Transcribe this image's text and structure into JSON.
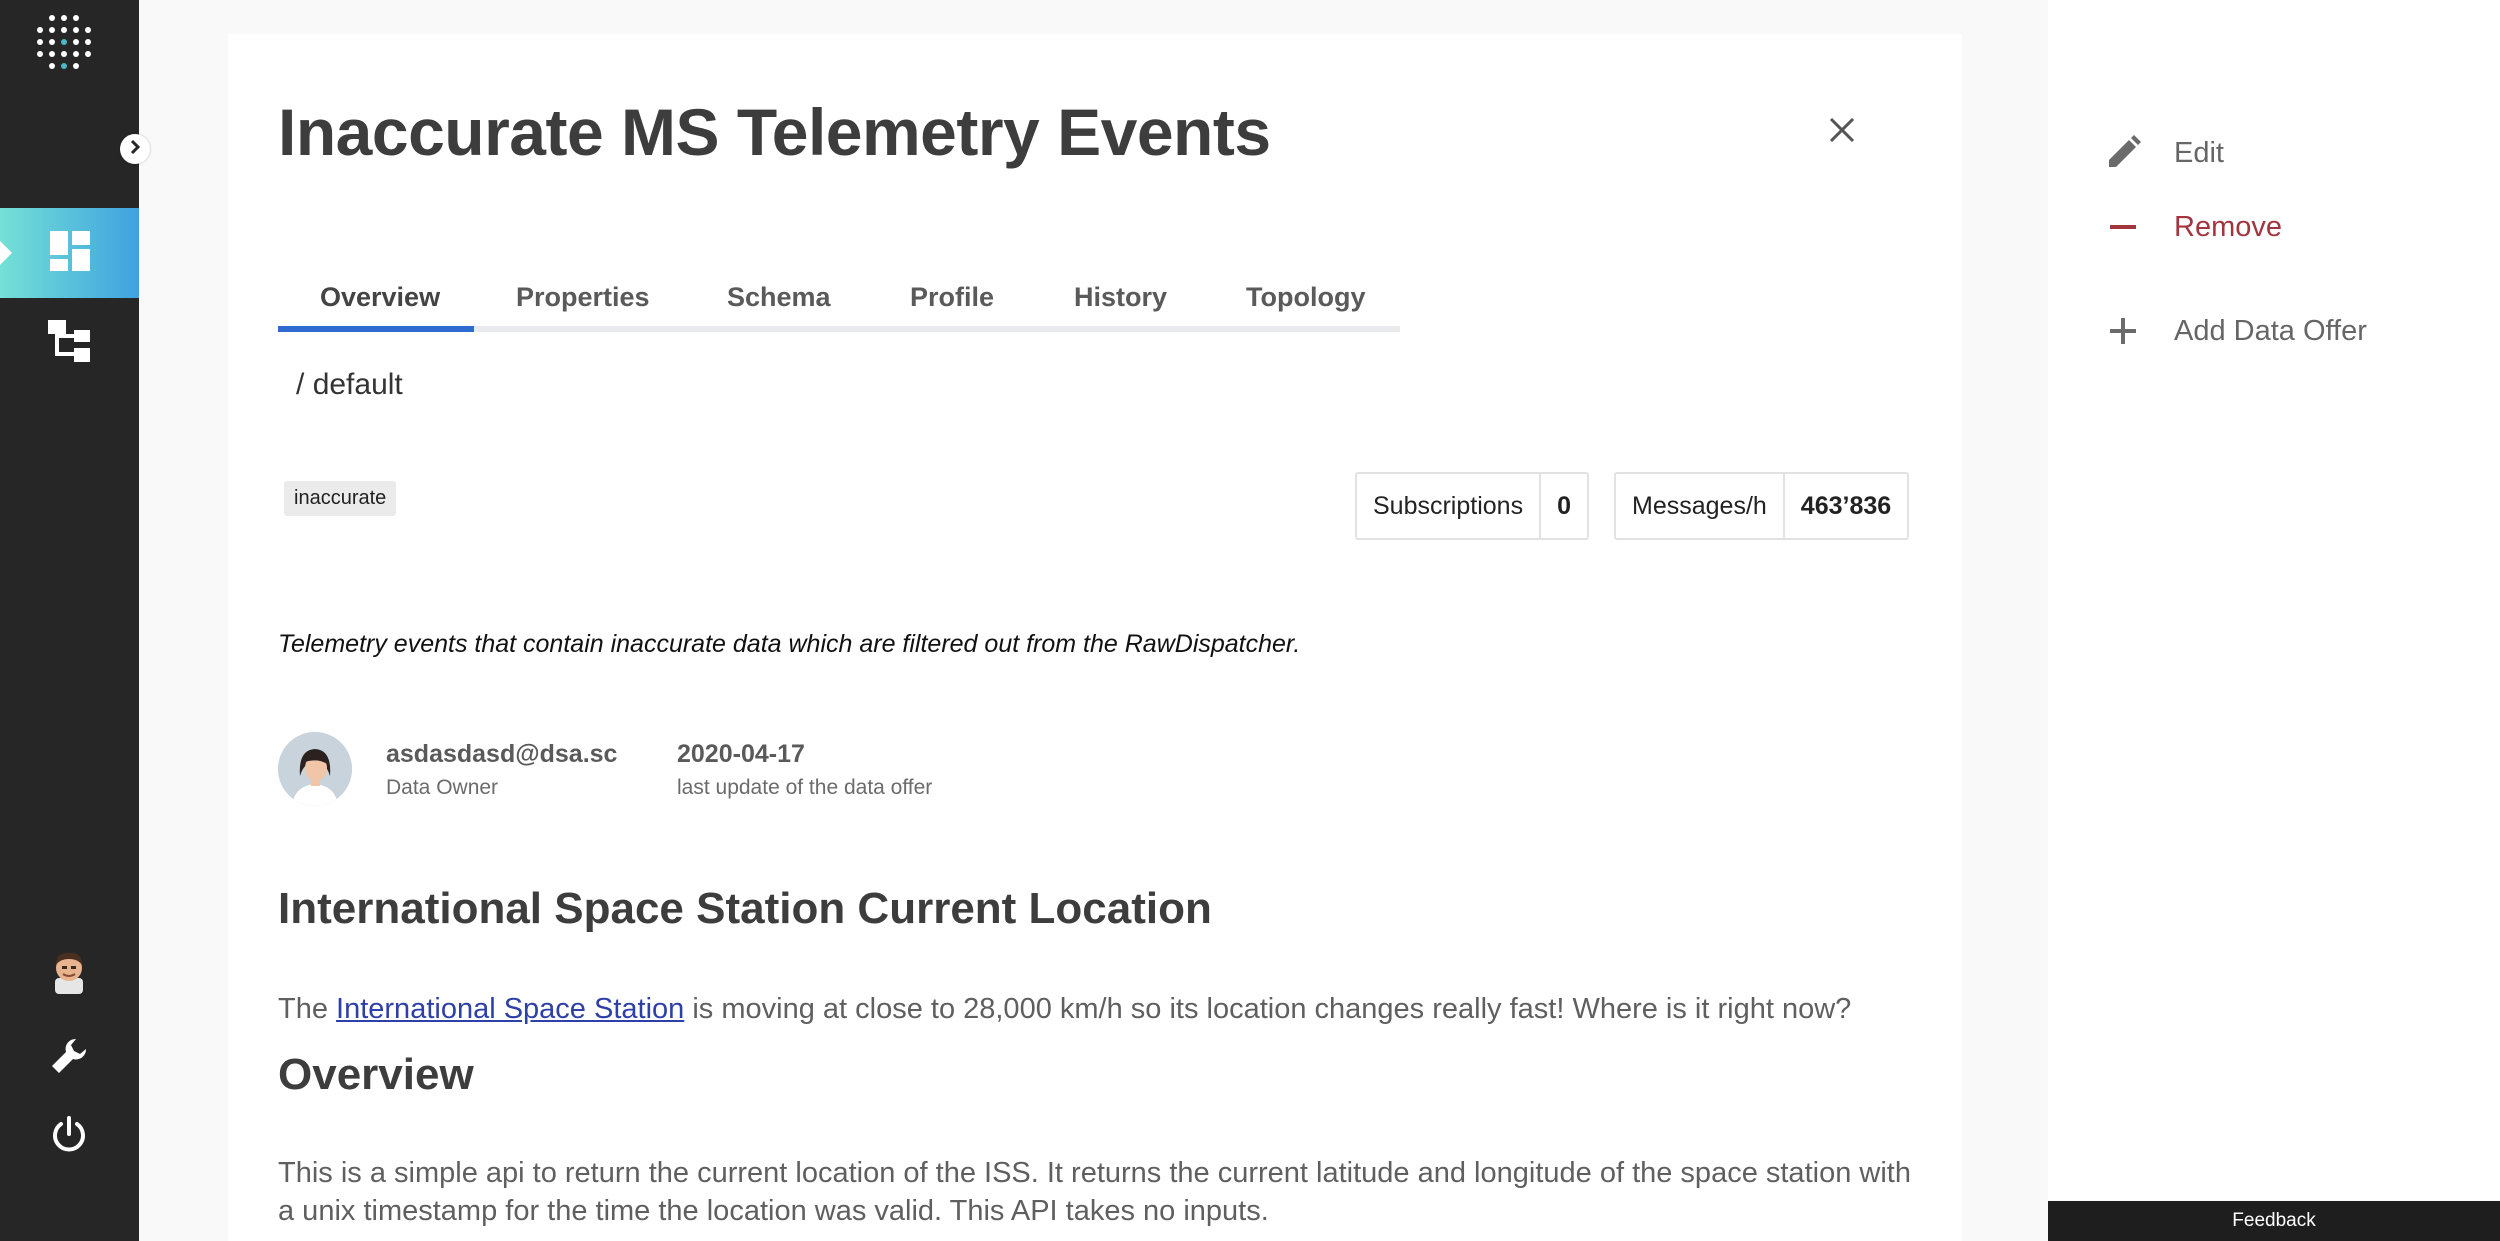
{
  "sidebar": {
    "items": [
      {
        "name": "dashboard",
        "icon": "dashboard-icon",
        "active": true
      },
      {
        "name": "topology",
        "icon": "hierarchy-icon",
        "active": false
      }
    ],
    "bottom": [
      {
        "name": "user-avatar",
        "icon": "avatar"
      },
      {
        "name": "tools",
        "icon": "wrench-icon"
      },
      {
        "name": "logout",
        "icon": "power-icon"
      }
    ],
    "accent_gradient": [
      "#74e0d6",
      "#3fa2e0"
    ]
  },
  "main": {
    "title": "Inaccurate MS Telemetry Events",
    "tabs": [
      {
        "label": "Overview",
        "active": true
      },
      {
        "label": "Properties"
      },
      {
        "label": "Schema"
      },
      {
        "label": "Profile"
      },
      {
        "label": "History"
      },
      {
        "label": "Topology"
      }
    ],
    "breadcrumb": {
      "slash": "/",
      "namespace": "default"
    },
    "tag": "inaccurate",
    "stats": {
      "subscriptions": {
        "label": "Subscriptions",
        "value": "0"
      },
      "messages": {
        "label": "Messages/h",
        "value": "463’836"
      }
    },
    "description": "Telemetry events that contain inaccurate data which are filtered out from the RawDispatcher.",
    "owner": {
      "email": "asdasdasd@dsa.sc",
      "role": "Data Owner"
    },
    "update": {
      "date": "2020-04-17",
      "label": "last update of the data offer"
    },
    "sections": [
      {
        "heading": "International Space Station Current Location",
        "text_before": "The ",
        "link": "International Space Station",
        "text_after": " is moving at close to 28,000 km/h so its location changes really fast! Where is it right now?"
      },
      {
        "heading": "Overview",
        "text": "This is a simple api to return the current location of the ISS. It returns the current latitude and longitude of the space station with a unix timestamp for the time the location was valid. This API takes no inputs."
      }
    ]
  },
  "actions": [
    {
      "label": "Edit",
      "icon": "pencil-icon"
    },
    {
      "label": "Remove",
      "icon": "minus-icon",
      "color": "#a3353f"
    },
    {
      "label": "Add Data Offer",
      "icon": "plus-icon"
    }
  ],
  "feedback_label": "Feedback",
  "colors": {
    "tab_active": "#2e6bd1",
    "link": "#2d3fa8",
    "danger": "#a3353f"
  }
}
